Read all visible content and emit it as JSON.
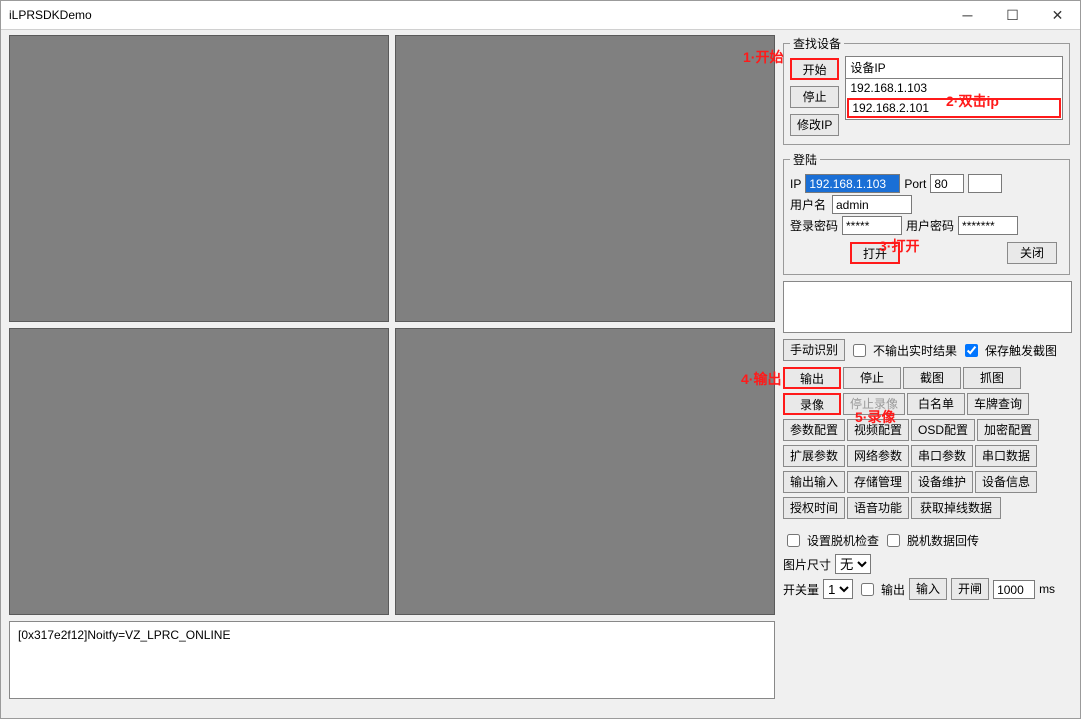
{
  "window": {
    "title": "iLPRSDKDemo"
  },
  "search": {
    "legend": "查找设备",
    "start_btn": "开始",
    "stop_btn": "停止",
    "modip_btn": "修改IP",
    "list_header": "设备IP",
    "ips": [
      "192.168.1.103",
      "192.168.2.101"
    ]
  },
  "login": {
    "legend": "登陆",
    "ip_lbl": "IP",
    "ip_val": "192.168.1.103",
    "port_lbl": "Port",
    "port_val": "80",
    "user_lbl": "用户名",
    "user_val": "admin",
    "loginpwd_lbl": "登录密码",
    "loginpwd_val": "*****",
    "userpwd_lbl": "用户密码",
    "userpwd_val": "*******",
    "open_btn": "打开",
    "close_btn": "关闭"
  },
  "ops": {
    "manual_btn": "手动识别",
    "chk_norealtime": "不输出实时结果",
    "chk_savetrig": "保存触发截图",
    "output_btn": "输出",
    "stop_btn": "停止",
    "snap_btn": "截图",
    "grab_btn": "抓图",
    "record_btn": "录像",
    "stoprec_btn": "停止录像",
    "whitelist_btn": "白名单",
    "platequery_btn": "车牌查询",
    "paramcfg_btn": "参数配置",
    "videocfg_btn": "视频配置",
    "osdcfg_btn": "OSD配置",
    "enccfg_btn": "加密配置",
    "extparam_btn": "扩展参数",
    "netparam_btn": "网络参数",
    "serialparam_btn": "串口参数",
    "serialdata_btn": "串口数据",
    "ioout_btn": "输出输入",
    "storage_btn": "存储管理",
    "maint_btn": "设备维护",
    "devinfo_btn": "设备信息",
    "authtime_btn": "授权时间",
    "voice_btn": "语音功能",
    "dropdata_btn": "获取掉线数据"
  },
  "misc": {
    "chk_offline": "设置脱机检查",
    "chk_offlinedata": "脱机数据回传",
    "imgsize_lbl": "图片尺寸",
    "imgsize_val": "无",
    "switch_lbl": "开关量",
    "switch_val": "1",
    "output_chk": "输出",
    "input_lbl": "输入",
    "open_btn": "开闸",
    "ms_val": "1000",
    "ms_lbl": "ms"
  },
  "log": "[0x317e2f12]Noitfy=VZ_LPRC_ONLINE",
  "annotations": {
    "a1": "1·开始",
    "a2": "2·双击ip",
    "a3": "3·打开",
    "a4": "4·输出",
    "a5": "5·录像"
  }
}
